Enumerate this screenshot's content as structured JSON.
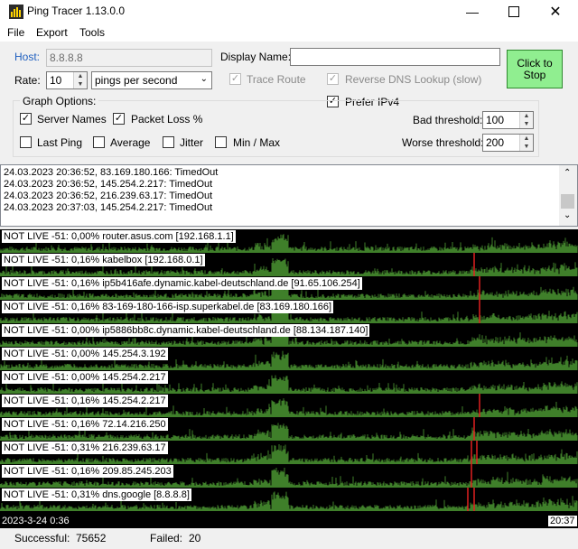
{
  "window": {
    "title": "Ping Tracer 1.13.0.0"
  },
  "menu": [
    "File",
    "Export",
    "Tools"
  ],
  "form": {
    "host_label": "Host:",
    "host_value": "8.8.8.8",
    "display_name_label": "Display Name:",
    "display_name_value": "",
    "rate_label": "Rate:",
    "rate_value": "10",
    "rate_unit": "pings per second",
    "trace_route": "Trace Route",
    "reverse_dns": "Reverse DNS Lookup (slow)",
    "prefer_ipv4": "Prefer IPv4",
    "start_stop": "Click to Stop",
    "graph_options": "Graph Options:",
    "server_names": "Server Names",
    "packet_loss": "Packet Loss %",
    "last_ping": "Last Ping",
    "average": "Average",
    "jitter": "Jitter",
    "min_max": "Min / Max",
    "bad_threshold_label": "Bad threshold:",
    "bad_threshold": "100",
    "worse_threshold_label": "Worse threshold:",
    "worse_threshold": "200"
  },
  "log": [
    "24.03.2023 20:36:52, 83.169.180.166: TimedOut",
    "24.03.2023 20:36:52, 145.254.2.217: TimedOut",
    "24.03.2023 20:36:52, 216.239.63.17: TimedOut",
    "24.03.2023 20:37:03, 145.254.2.217: TimedOut"
  ],
  "graphs": [
    {
      "label": "NOT LIVE -51: 0,00% router.asus.com [192.168.1.1]",
      "fail_at": []
    },
    {
      "label": "NOT LIVE -51: 0,16% kabelbox [192.168.0.1]",
      "fail_at": [
        0.82
      ]
    },
    {
      "label": "NOT LIVE -51: 0,16% ip5b416afe.dynamic.kabel-deutschland.de [91.65.106.254]",
      "fail_at": [
        0.83
      ]
    },
    {
      "label": "NOT LIVE -51: 0,16% 83-169-180-166-isp.superkabel.de [83.169.180.166]",
      "fail_at": [
        0.83
      ]
    },
    {
      "label": "NOT LIVE -51: 0,00% ip5886bb8c.dynamic.kabel-deutschland.de [88.134.187.140]",
      "fail_at": []
    },
    {
      "label": "NOT LIVE -51: 0,00% 145.254.3.192",
      "fail_at": []
    },
    {
      "label": "NOT LIVE -51: 0,00% 145.254.2.217",
      "fail_at": []
    },
    {
      "label": "NOT LIVE -51: 0,16% 145.254.2.217",
      "fail_at": [
        0.83
      ]
    },
    {
      "label": "NOT LIVE -51: 0,16% 72.14.216.250",
      "fail_at": [
        0.82
      ]
    },
    {
      "label": "NOT LIVE -51: 0,31% 216.239.63.17",
      "fail_at": [
        0.815,
        0.825
      ]
    },
    {
      "label": "NOT LIVE -51: 0,16% 209.85.245.203",
      "fail_at": [
        0.815
      ]
    },
    {
      "label": "NOT LIVE -51: 0,31% dns.google [8.8.8.8]",
      "fail_at": [
        0.81,
        0.82
      ]
    }
  ],
  "time_start": "2023-3-24 0:36",
  "time_end": "20:37",
  "status": {
    "successful_label": "Successful:",
    "successful": "75652",
    "failed_label": "Failed:",
    "failed": "20"
  }
}
